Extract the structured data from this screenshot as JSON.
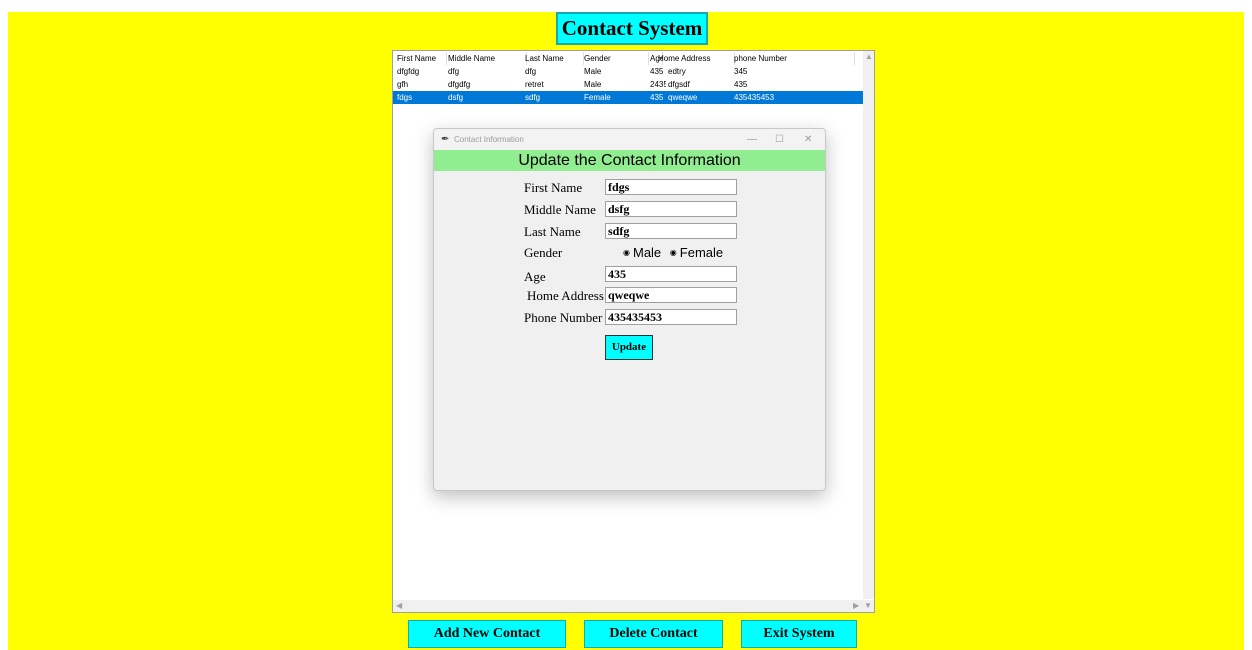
{
  "app": {
    "title": "Contact System",
    "background": "#ffff00",
    "accent": "#00ffff"
  },
  "tree": {
    "columns": [
      "First Name",
      "Middle Name",
      "Last Name",
      "Gender",
      "Age",
      "Home Address",
      "phone Number"
    ],
    "rows": [
      [
        "dfgfdg",
        "dfg",
        "dfg",
        "Male",
        "435",
        "edtry",
        "345"
      ],
      [
        "gfh",
        "dfgdfg",
        "retret",
        "Male",
        "2435",
        "dfgsdf",
        "435"
      ],
      [
        "fdgs",
        "dsfg",
        "sdfg",
        "Female",
        "435",
        "qweqwe",
        "435435453"
      ]
    ],
    "selected_row": 2,
    "selection_color": "#0078d7"
  },
  "dialog": {
    "window_title": "Contact Information",
    "header": "Update the Contact Information",
    "header_color": "#90ee90",
    "labels": {
      "first_name": "First Name",
      "middle_name": "Middle Name",
      "last_name": "Last Name",
      "gender": "Gender",
      "age": "Age",
      "home_address": "Home Address",
      "phone_number": "Phone Number"
    },
    "values": {
      "first_name": "fdgs",
      "middle_name": "dsfg",
      "last_name": "sdfg",
      "age": "435",
      "home_address": "qweqwe",
      "phone_number": "435435453"
    },
    "gender_options": [
      "Male",
      "Female"
    ],
    "gender_selected": "Female",
    "update_label": "Update",
    "window_buttons": {
      "minimize": "—",
      "maximize": "☐",
      "close": "✕"
    }
  },
  "buttons": {
    "add": "Add New Contact",
    "delete": "Delete Contact",
    "exit": "Exit System"
  },
  "icons": [
    "feather-icon",
    "scroll-up-arrow-icon",
    "scroll-left-arrow-icon",
    "scroll-right-arrow-icon",
    "scroll-down-arrow-icon"
  ]
}
